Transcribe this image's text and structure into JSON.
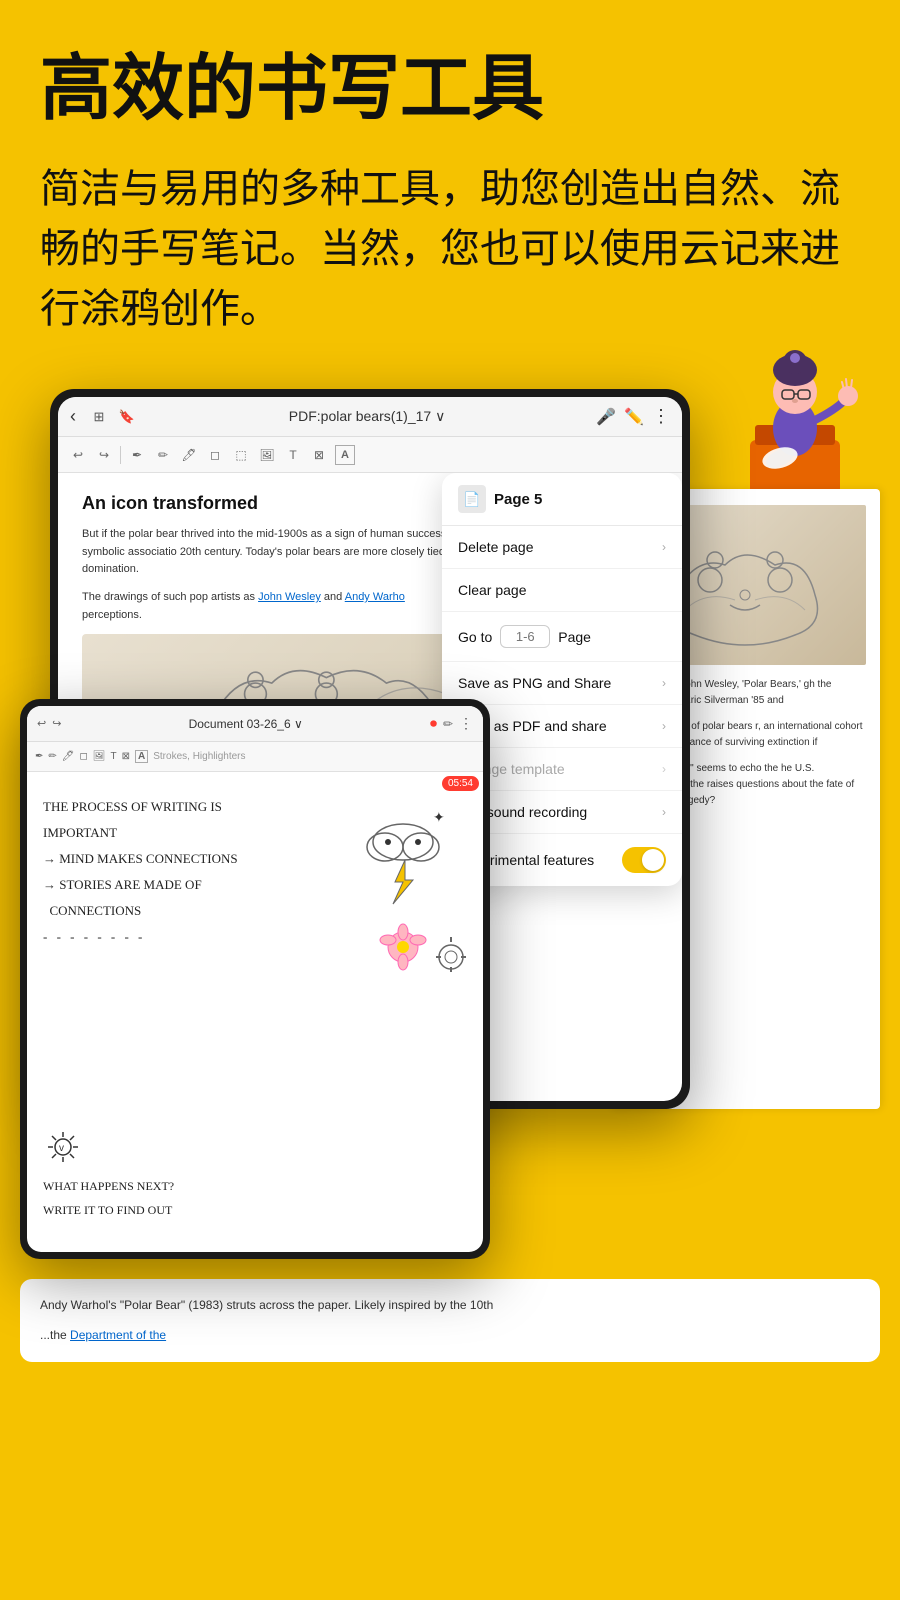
{
  "hero": {
    "title": "高效的书写工具",
    "description": "简洁与易用的多种工具，助您创造出自然、流畅的手写笔记。当然，您也可以使用云记来进行涂鸦创作。"
  },
  "tablet_main": {
    "toolbar": {
      "back_label": "‹",
      "title": "PDF:polar bears(1)_17 ∨",
      "undo": "↩",
      "redo": "↪"
    },
    "pdf": {
      "title": "An icon transformed",
      "para1": "But if the polar bear thrived into the mid-1900s as a sign of human successful mastery of antagonistic forces, this symbolic associatio 20th century. Today's polar bears are more closely tied to the dem belief in conquest and domination.",
      "para2": "The drawings of such pop artists as John Wesley and Andy Warho perceptions."
    }
  },
  "dropdown": {
    "page_label": "Page 5",
    "items": [
      {
        "label": "Delete page",
        "chevron": true,
        "disabled": false
      },
      {
        "label": "Clear page",
        "chevron": false,
        "disabled": false
      },
      {
        "label": "Go to",
        "goto": true,
        "goto_placeholder": "1-6",
        "page_text": "Page",
        "disabled": false
      },
      {
        "label": "Save as PNG and Share",
        "chevron": true,
        "disabled": false
      },
      {
        "label": "Save as PDF and share",
        "chevron": true,
        "disabled": false
      },
      {
        "label": "Change template",
        "chevron": true,
        "disabled": true
      },
      {
        "label": "Add sound recording",
        "chevron": true,
        "disabled": false
      },
      {
        "label": "Experimental features",
        "toggle": true,
        "disabled": false
      }
    ]
  },
  "tablet_small": {
    "toolbar_title": "Document 03-26_6 ∨",
    "timer": "05:54",
    "strokes_label": "Strokes, Highlighters",
    "handwriting": [
      "THE PROCESS OF WRITING IS",
      "IMPORTANT",
      "→ MIND MAKES CONNECTIONS",
      "→ STORIES ARE MADE OF",
      "  CONNECTIONS",
      "- - - - - - - -"
    ],
    "bottom_lines": [
      "WHAT HAPPENS NEXT?",
      "WRITE IT TO FIND OUT"
    ]
  },
  "pdf_overlay": {
    "text1": "mber mood. John Wesley, 'Polar Bears,' gh the generosity of Eric Silverman '85 and",
    "text2": "rtwined bodies of polar bears r, an international cohort of scientists chance of surviving extinction if",
    "text3": "reat white bear\" seems to echo the he U.S. Department of the raises questions about the fate of the n fact a tragedy?"
  },
  "bottom_section": {
    "text": "Andy Warhol's \"Polar Bear\" (1983) struts across the paper. Likely inspired by the 10th",
    "dept_text": "Department of the"
  },
  "colors": {
    "bg_yellow": "#F5C200",
    "toggle_yellow": "#F5C200",
    "accent_yellow": "#C8A000"
  }
}
